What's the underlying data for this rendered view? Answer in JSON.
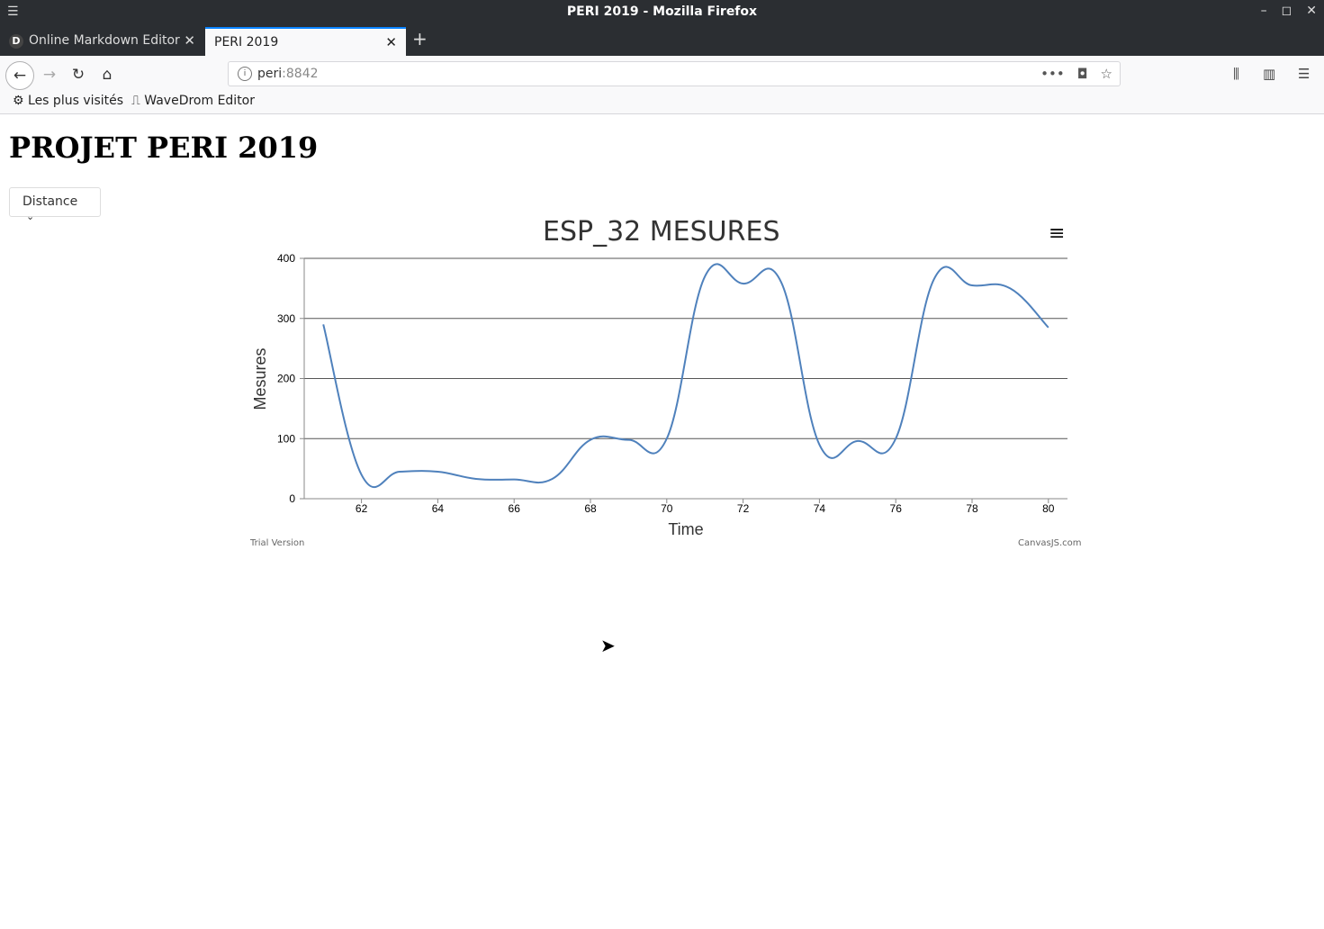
{
  "window": {
    "title": "PERI 2019 - Mozilla Firefox",
    "buttons": [
      "–",
      "◻",
      "✕"
    ]
  },
  "tabs": [
    {
      "label": "Online Markdown Editor",
      "favicon": "D"
    },
    {
      "label": "PERI 2019"
    }
  ],
  "address": {
    "host": "peri",
    "port": ":8842"
  },
  "bookmarks": [
    {
      "label": "Les plus visités",
      "icon": "gear-icon"
    },
    {
      "label": "WaveDrom Editor",
      "icon": "wavedrom-icon"
    }
  ],
  "page": {
    "heading": "PROJET PERI 2019",
    "dropdown_label": "Distance"
  },
  "chart_data": {
    "type": "line",
    "title": "ESP_32 MESURES",
    "xlabel": "Time",
    "ylabel": "Mesures",
    "xlim": [
      60.5,
      80.5
    ],
    "ylim": [
      0,
      400
    ],
    "xticks": [
      62,
      64,
      66,
      68,
      70,
      72,
      74,
      76,
      78,
      80
    ],
    "yticks": [
      0,
      100,
      200,
      300,
      400
    ],
    "grid": true,
    "color": "#4f81bc",
    "x": [
      61,
      62,
      63,
      64,
      65,
      66,
      67,
      68,
      69,
      70,
      71,
      72,
      73,
      74,
      75,
      76,
      77,
      78,
      79,
      80
    ],
    "y": [
      290,
      40,
      45,
      45,
      33,
      32,
      33,
      98,
      98,
      100,
      370,
      358,
      360,
      90,
      96,
      100,
      365,
      355,
      350,
      285
    ],
    "watermark_left": "Trial Version",
    "watermark_right": "CanvasJS.com"
  }
}
